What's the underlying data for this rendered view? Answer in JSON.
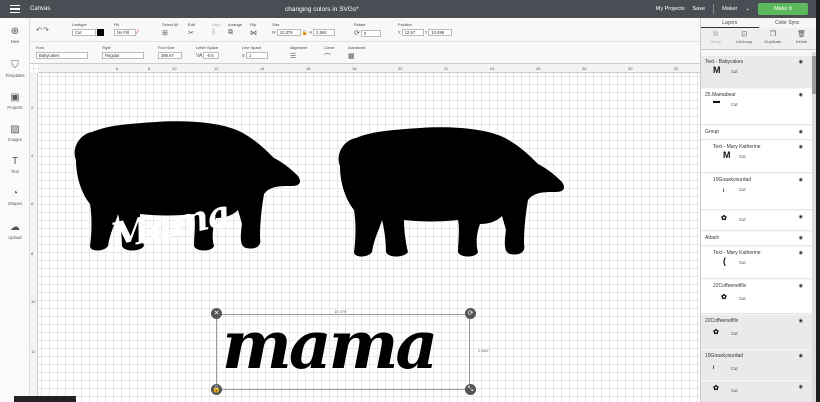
{
  "topbar": {
    "app_name": "Canvas",
    "doc_title": "changing colors in SVGs*",
    "my_projects": "My Projects",
    "save": "Save",
    "machine": "Maker",
    "make_it": "Make It"
  },
  "leftbar": [
    {
      "label": "New",
      "icon": "plus-icon"
    },
    {
      "label": "Templates",
      "icon": "shirt-icon"
    },
    {
      "label": "Projects",
      "icon": "projects-icon"
    },
    {
      "label": "Images",
      "icon": "image-icon"
    },
    {
      "label": "Text",
      "icon": "text-icon"
    },
    {
      "label": "Shapes",
      "icon": "shapes-icon"
    },
    {
      "label": "Upload",
      "icon": "upload-icon"
    }
  ],
  "toolbar1": {
    "linetype_label": "Linetype",
    "linetype_value": "Cut",
    "fill_label": "Fill",
    "fill_value": "No Fill",
    "select_all_label": "Select All",
    "edit_label": "Edit",
    "align_label": "Align",
    "arrange_label": "Arrange",
    "flip_label": "Flip",
    "size_label": "Size",
    "w_label": "W",
    "w_value": "10.379",
    "h_label": "H",
    "h_value": "2.584",
    "rotate_label": "Rotate",
    "rotate_value": "0",
    "position_label": "Position",
    "x_label": "X",
    "x_value": "12.57",
    "y_label": "Y",
    "y_value": "10.698"
  },
  "toolbar2": {
    "font_label": "Font",
    "font_value": "Babycakes",
    "style_label": "Style",
    "style_value": "Regular",
    "font_size_label": "Font Size",
    "font_size_value": "366.67",
    "letter_space_label": "Letter Space",
    "letter_space_value": "-0.6",
    "line_space_label": "Line Space",
    "line_space_value": "1",
    "alignment_label": "Alignment",
    "curve_label": "Curve",
    "advanced_label": "Advanced"
  },
  "ruler_h": [
    "6",
    "8",
    "10",
    "12",
    "14",
    "16",
    "18",
    "20",
    "22",
    "24",
    "26",
    "28",
    "30",
    "32"
  ],
  "ruler_v": [
    "2",
    "4",
    "6",
    "8",
    "10",
    "12"
  ],
  "canvas": {
    "bear_text": "Mama",
    "selected_text": "mama",
    "selection_width": "10.379\"",
    "selection_height": "2.584\""
  },
  "rightpanel": {
    "tab_layers": "Layers",
    "tab_color_sync": "Color Sync",
    "tools": [
      "Group",
      "UnGroup",
      "Duplicate",
      "Delete"
    ],
    "layers": [
      {
        "name": "Text - Babycakes",
        "sub": "Cut",
        "thumb": "M",
        "type": "header"
      },
      {
        "name": "25.Mamabear",
        "sub": "Cut",
        "thumb": "bear",
        "type": "header"
      },
      {
        "name": "Group",
        "type": "group"
      },
      {
        "name": "Text - Mary Katherine",
        "sub": "Cut",
        "thumb": "M",
        "type": "child"
      },
      {
        "name": "19Goaskyourdad",
        "sub": "Cut",
        "thumb": "i",
        "type": "child"
      },
      {
        "name": "",
        "sub": "Cut",
        "thumb": "art",
        "type": "leaf"
      },
      {
        "name": "Attach",
        "type": "group"
      },
      {
        "name": "Text - Mary Katherine",
        "sub": "Cut",
        "thumb": "(",
        "type": "child"
      },
      {
        "name": "22Coffeenetflix",
        "sub": "Cut",
        "thumb": "art",
        "type": "child"
      },
      {
        "name": "22Coffeenetflix",
        "sub": "Cut",
        "thumb": "art",
        "type": "header"
      },
      {
        "name": "19Goaskyourdad",
        "sub": "Cut",
        "thumb": "i",
        "type": "header"
      },
      {
        "name": "",
        "sub": "Cut",
        "thumb": "art",
        "type": "leaf"
      }
    ]
  },
  "colors": {
    "topbar": "#4a4e54",
    "make_it": "#5cb85c",
    "shape": "#000000"
  }
}
